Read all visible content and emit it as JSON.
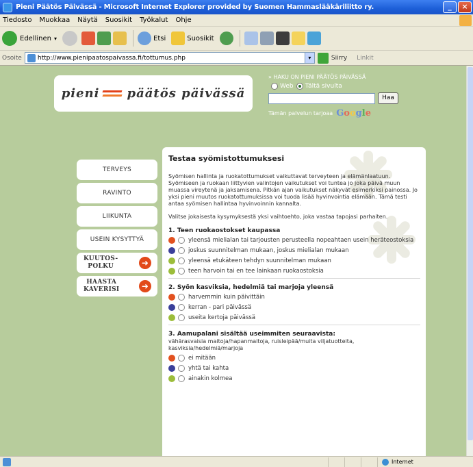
{
  "window": {
    "title": "Pieni Päätös Päivässä - Microsoft Internet Explorer provided by Suomen Hammaslääkäriliitto ry."
  },
  "menu": [
    "Tiedosto",
    "Muokkaa",
    "Näytä",
    "Suosikit",
    "Työkalut",
    "Ohje"
  ],
  "toolbar": {
    "back": "Edellinen",
    "search": "Etsi",
    "favorites": "Suosikit"
  },
  "address": {
    "label": "Osoite",
    "url": "http://www.pienipaatospaivassa.fi/tottumus.php",
    "links": "Siirry",
    "links2": "Linkit"
  },
  "site": {
    "title_part1": "pieni",
    "title_part2": "päätös päivässä",
    "search": {
      "caption": "» HAKU ON PIENI PÄÄTÖS PÄIVÄSSÄ",
      "opt_web": "Web",
      "opt_site": "Tältä sivulta",
      "button": "Haa",
      "powered": "Tämän palvelun tarjoaa"
    },
    "google": [
      "G",
      "o",
      "o",
      "g",
      "l",
      "e"
    ]
  },
  "nav": {
    "items": [
      "TERVEYS",
      "RAVINTO",
      "LIIKUNTA",
      "USEIN KYSYTTYÄ"
    ],
    "arrows": [
      "KUUTOS-\nPOLKU",
      "HAASTA\nKAVERISI"
    ]
  },
  "content": {
    "title": "Testaa syömistottumuksesi",
    "intro": "Syömisen hallinta ja ruokatottumukset vaikuttavat terveyteen ja elämänlaatuun. Syömiseen ja ruokaan liittyvien valintojen vaikutukset voi tuntea jo joka päivä muun muassa vireytenä ja jaksamisena. Pitkän ajan vaikutukset näkyvät esimerkiksi painossa. Jo yksi pieni muutos ruokatottumuksissa voi tuoda lisää hyvinvointia elämään. Tämä testi antaa syömisen hallintaa hyvinvoinnin kannalta.",
    "instruction": "Valitse jokaisesta kysymyksestä yksi vaihtoehto, joka vastaa tapojasi parhaiten.",
    "questions": [
      {
        "title": "1. Teen ruokaostokset kaupassa",
        "sub": "",
        "options": [
          {
            "color": "#e2511f",
            "text": "yleensä mielialan tai tarjousten perusteella nopeahtaen usein heräteostoksia"
          },
          {
            "color": "#3a3f9a",
            "text": "joskus suunnitelman mukaan, joskus mielialan mukaan"
          },
          {
            "color": "#9cbd3a",
            "text": "yleensä etukäteen tehdyn suunnitelman mukaan"
          },
          {
            "color": "#9cbd3a",
            "text": "teen harvoin tai en tee lainkaan ruokaostoksia"
          }
        ]
      },
      {
        "title": "2. Syön kasviksia, hedelmiä tai marjoja yleensä",
        "sub": "",
        "options": [
          {
            "color": "#e2511f",
            "text": "harvemmin kuin päivittäin"
          },
          {
            "color": "#3a3f9a",
            "text": "kerran - pari päivässä"
          },
          {
            "color": "#9cbd3a",
            "text": "useita kertoja päivässä"
          }
        ]
      },
      {
        "title": "3. Aamupalani sisältää useimmiten seuraavista:",
        "sub": "vähärasvaisia maitoja/hapanmaitoja, ruisleipää/muita viljatuotteita, kasviksia/hedelmiä/marjoja",
        "options": [
          {
            "color": "#e2511f",
            "text": "ei mitään"
          },
          {
            "color": "#3a3f9a",
            "text": "yhtä tai kahta"
          },
          {
            "color": "#9cbd3a",
            "text": "ainakin kolmea"
          }
        ]
      }
    ]
  },
  "status": {
    "zone": "Internet"
  }
}
